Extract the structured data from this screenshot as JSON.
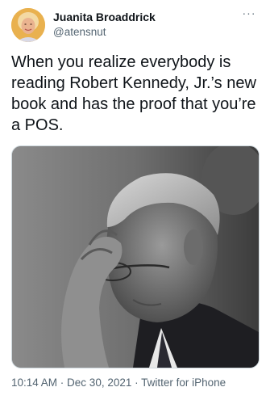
{
  "author": {
    "name": "Juanita Broaddrick",
    "handle": "@atensnut",
    "avatar_icon": "user-avatar-photo"
  },
  "more_icon": "more-horizontal-icon",
  "more_glyph": "···",
  "tweet": {
    "text": "When you realize everybody is reading Robert Kennedy, Jr.’s new book and has the proof that you’re a POS."
  },
  "media": {
    "type": "photo",
    "icon": "attached-photo-man-hand-on-forehead"
  },
  "meta": {
    "time": "10:14 AM",
    "separator": " · ",
    "date": "Dec 30, 2021",
    "source": "Twitter for iPhone"
  },
  "colors": {
    "text_primary": "#0f1419",
    "text_secondary": "#536471",
    "border": "#cfd9de"
  }
}
